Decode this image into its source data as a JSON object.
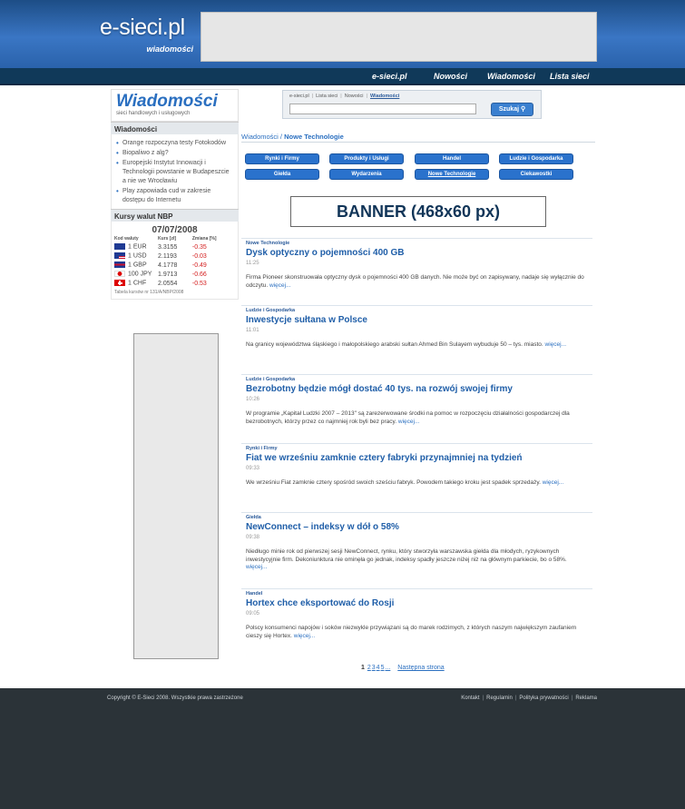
{
  "header": {
    "logo_main": "e-sieci.pl",
    "logo_sub": "wiadomości"
  },
  "nav": {
    "items": [
      "e-sieci.pl",
      "Nowości",
      "Wiadomości",
      "Lista sieci"
    ]
  },
  "sidebar": {
    "logo_title": "Wiadomości",
    "logo_subtitle": "sieci handlowych i usługowych",
    "news_heading": "Wiadomości",
    "news": [
      "Orange rozpoczyna testy Fotokodów",
      "Biopaliwo z alg?",
      "Europejski Instytut Innowacji i Technologii powstanie w Budapeszcie a nie we Wrocławiu",
      "Play zapowiada cud w zakresie dostępu do Internetu"
    ],
    "rates_heading": "Kursy walut NBP",
    "rates_date": "07/07/2008",
    "rates_headers": [
      "Kod waluty",
      "Kurs [zł]",
      "Zmiana [%]"
    ],
    "rates": [
      {
        "code": "1 EUR",
        "rate": "3.3155",
        "change": "-0.35",
        "flag": "eu"
      },
      {
        "code": "1 USD",
        "rate": "2.1193",
        "change": "-0.03",
        "flag": "us"
      },
      {
        "code": "1 GBP",
        "rate": "4.1778",
        "change": "-0.49",
        "flag": "gb"
      },
      {
        "code": "100 JPY",
        "rate": "1.9713",
        "change": "-0.66",
        "flag": "jp"
      },
      {
        "code": "1 CHF",
        "rate": "2.0554",
        "change": "-0.53",
        "flag": "ch"
      }
    ],
    "rates_note": "Tabela kursów nr 131/A/NBP/2008"
  },
  "search": {
    "tabs": [
      "e-sieci.pl",
      "Lista sieci",
      "Nowości",
      "Wiadomości"
    ],
    "active_tab": "Wiadomości",
    "input_value": "",
    "button_label": "Szukaj"
  },
  "breadcrumb": {
    "parent": "Wiadomości",
    "current": "Nowe Technologie"
  },
  "categories": [
    "Rynki i Firmy",
    "Produkty i Usługi",
    "Handel",
    "Ludzie i Gospodarka",
    "Giełda",
    "Wydarzenia",
    "Nowe Technologie",
    "Ciekawostki"
  ],
  "banner_text": "BANNER (468x60 px)",
  "articles": [
    {
      "category": "Nowe Technologie",
      "title": "Dysk optyczny o pojemności 400 GB",
      "time": "11:25",
      "body": "Firma Pioneer skonstruowała optyczny dysk o pojemności 400 GB danych. Nie może być on zapisywany, nadaje się wyłącznie do odczytu.",
      "more": "więcej..."
    },
    {
      "category": "Ludzie i Gospodarka",
      "title": "Inwestycje sułtana w Polsce",
      "time": "11:01",
      "body": "Na granicy województwa śląskiego i małopolskiego arabski sułtan Ahmed Bin Sulayem wybuduje 50 – tys. miasto.",
      "more": "więcej..."
    },
    {
      "category": "Ludzie i Gospodarka",
      "title": "Bezrobotny będzie mógł dostać 40 tys. na rozwój swojej firmy",
      "time": "10:26",
      "body": "W programie „Kapitał Ludzki 2007 – 2013\" są zarezerwowane środki na pomoc w rozpoczęciu działalności gospodarczej dla bezrobotnych, którzy przez co najmniej rok byli bez pracy.",
      "more": "więcej..."
    },
    {
      "category": "Rynki i Firmy",
      "title": "Fiat we wrześniu zamknie cztery fabryki przynajmniej na tydzień",
      "time": "09:33",
      "body": "We wrześniu Fiat zamknie cztery spośród swoich sześciu fabryk. Powodem takiego kroku jest spadek sprzedaży.",
      "more": "więcej..."
    },
    {
      "category": "Giełda",
      "title": "NewConnect – indeksy w dół o 58%",
      "time": "09:38",
      "body": "Niedługo minie rok od pierwszej sesji NewConnect, rynku, który stworzyła warszawska giełda dla młodych, ryzykownych inwestycyjnie firm. Dekoniunktura nie ominęła go jednak, indeksy spadły jeszcze niżej niż na głównym parkiecie, bo o 58%.",
      "more": "więcej..."
    },
    {
      "category": "Handel",
      "title": "Hortex chce eksportować do Rosji",
      "time": "09:05",
      "body": "Polscy konsumenci napojów i soków niezwykle przywiązani są do marek rodzimych, z których naszym największym zaufaniem cieszy się Hortex.",
      "more": "więcej..."
    }
  ],
  "pager": {
    "current": "1",
    "pages": [
      "2",
      "3",
      "4",
      "5",
      "..."
    ],
    "next_label": "Następna strona"
  },
  "footer": {
    "copyright": "Copyright © E-Sieci 2008. Wszystkie prawa zastrzeżone",
    "links": [
      "Kontakt",
      "Regulamin",
      "Polityka prywatności",
      "Reklama"
    ]
  }
}
